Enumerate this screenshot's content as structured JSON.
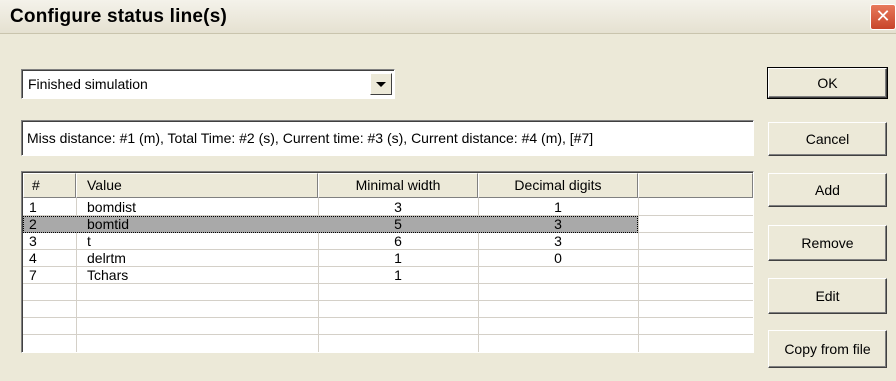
{
  "window": {
    "title": "Configure status line(s)"
  },
  "status_select": {
    "value": "Finished simulation"
  },
  "format_field": {
    "value": "Miss distance: #1 (m), Total Time: #2 (s), Current time: #3 (s), Current distance: #4 (m), [#7]"
  },
  "table": {
    "columns": [
      "#",
      "Value",
      "Minimal width",
      "Decimal digits",
      ""
    ],
    "rows": [
      {
        "num": "1",
        "value": "bomdist",
        "width": "3",
        "digits": "1"
      },
      {
        "num": "2",
        "value": "bomtid",
        "width": "5",
        "digits": "3",
        "selected": true
      },
      {
        "num": "3",
        "value": "t",
        "width": "6",
        "digits": "3"
      },
      {
        "num": "4",
        "value": "delrtm",
        "width": "1",
        "digits": "0"
      },
      {
        "num": "7",
        "value": "Tchars",
        "width": "1",
        "digits": ""
      }
    ]
  },
  "buttons": {
    "ok": "OK",
    "cancel": "Cancel",
    "add": "Add",
    "remove": "Remove",
    "edit": "Edit",
    "copy_from_file": "Copy from file"
  },
  "colors": {
    "selected_row": "#a9a9a9",
    "dialog_bg": "#ece9d8",
    "close_button": "#c8452b"
  }
}
